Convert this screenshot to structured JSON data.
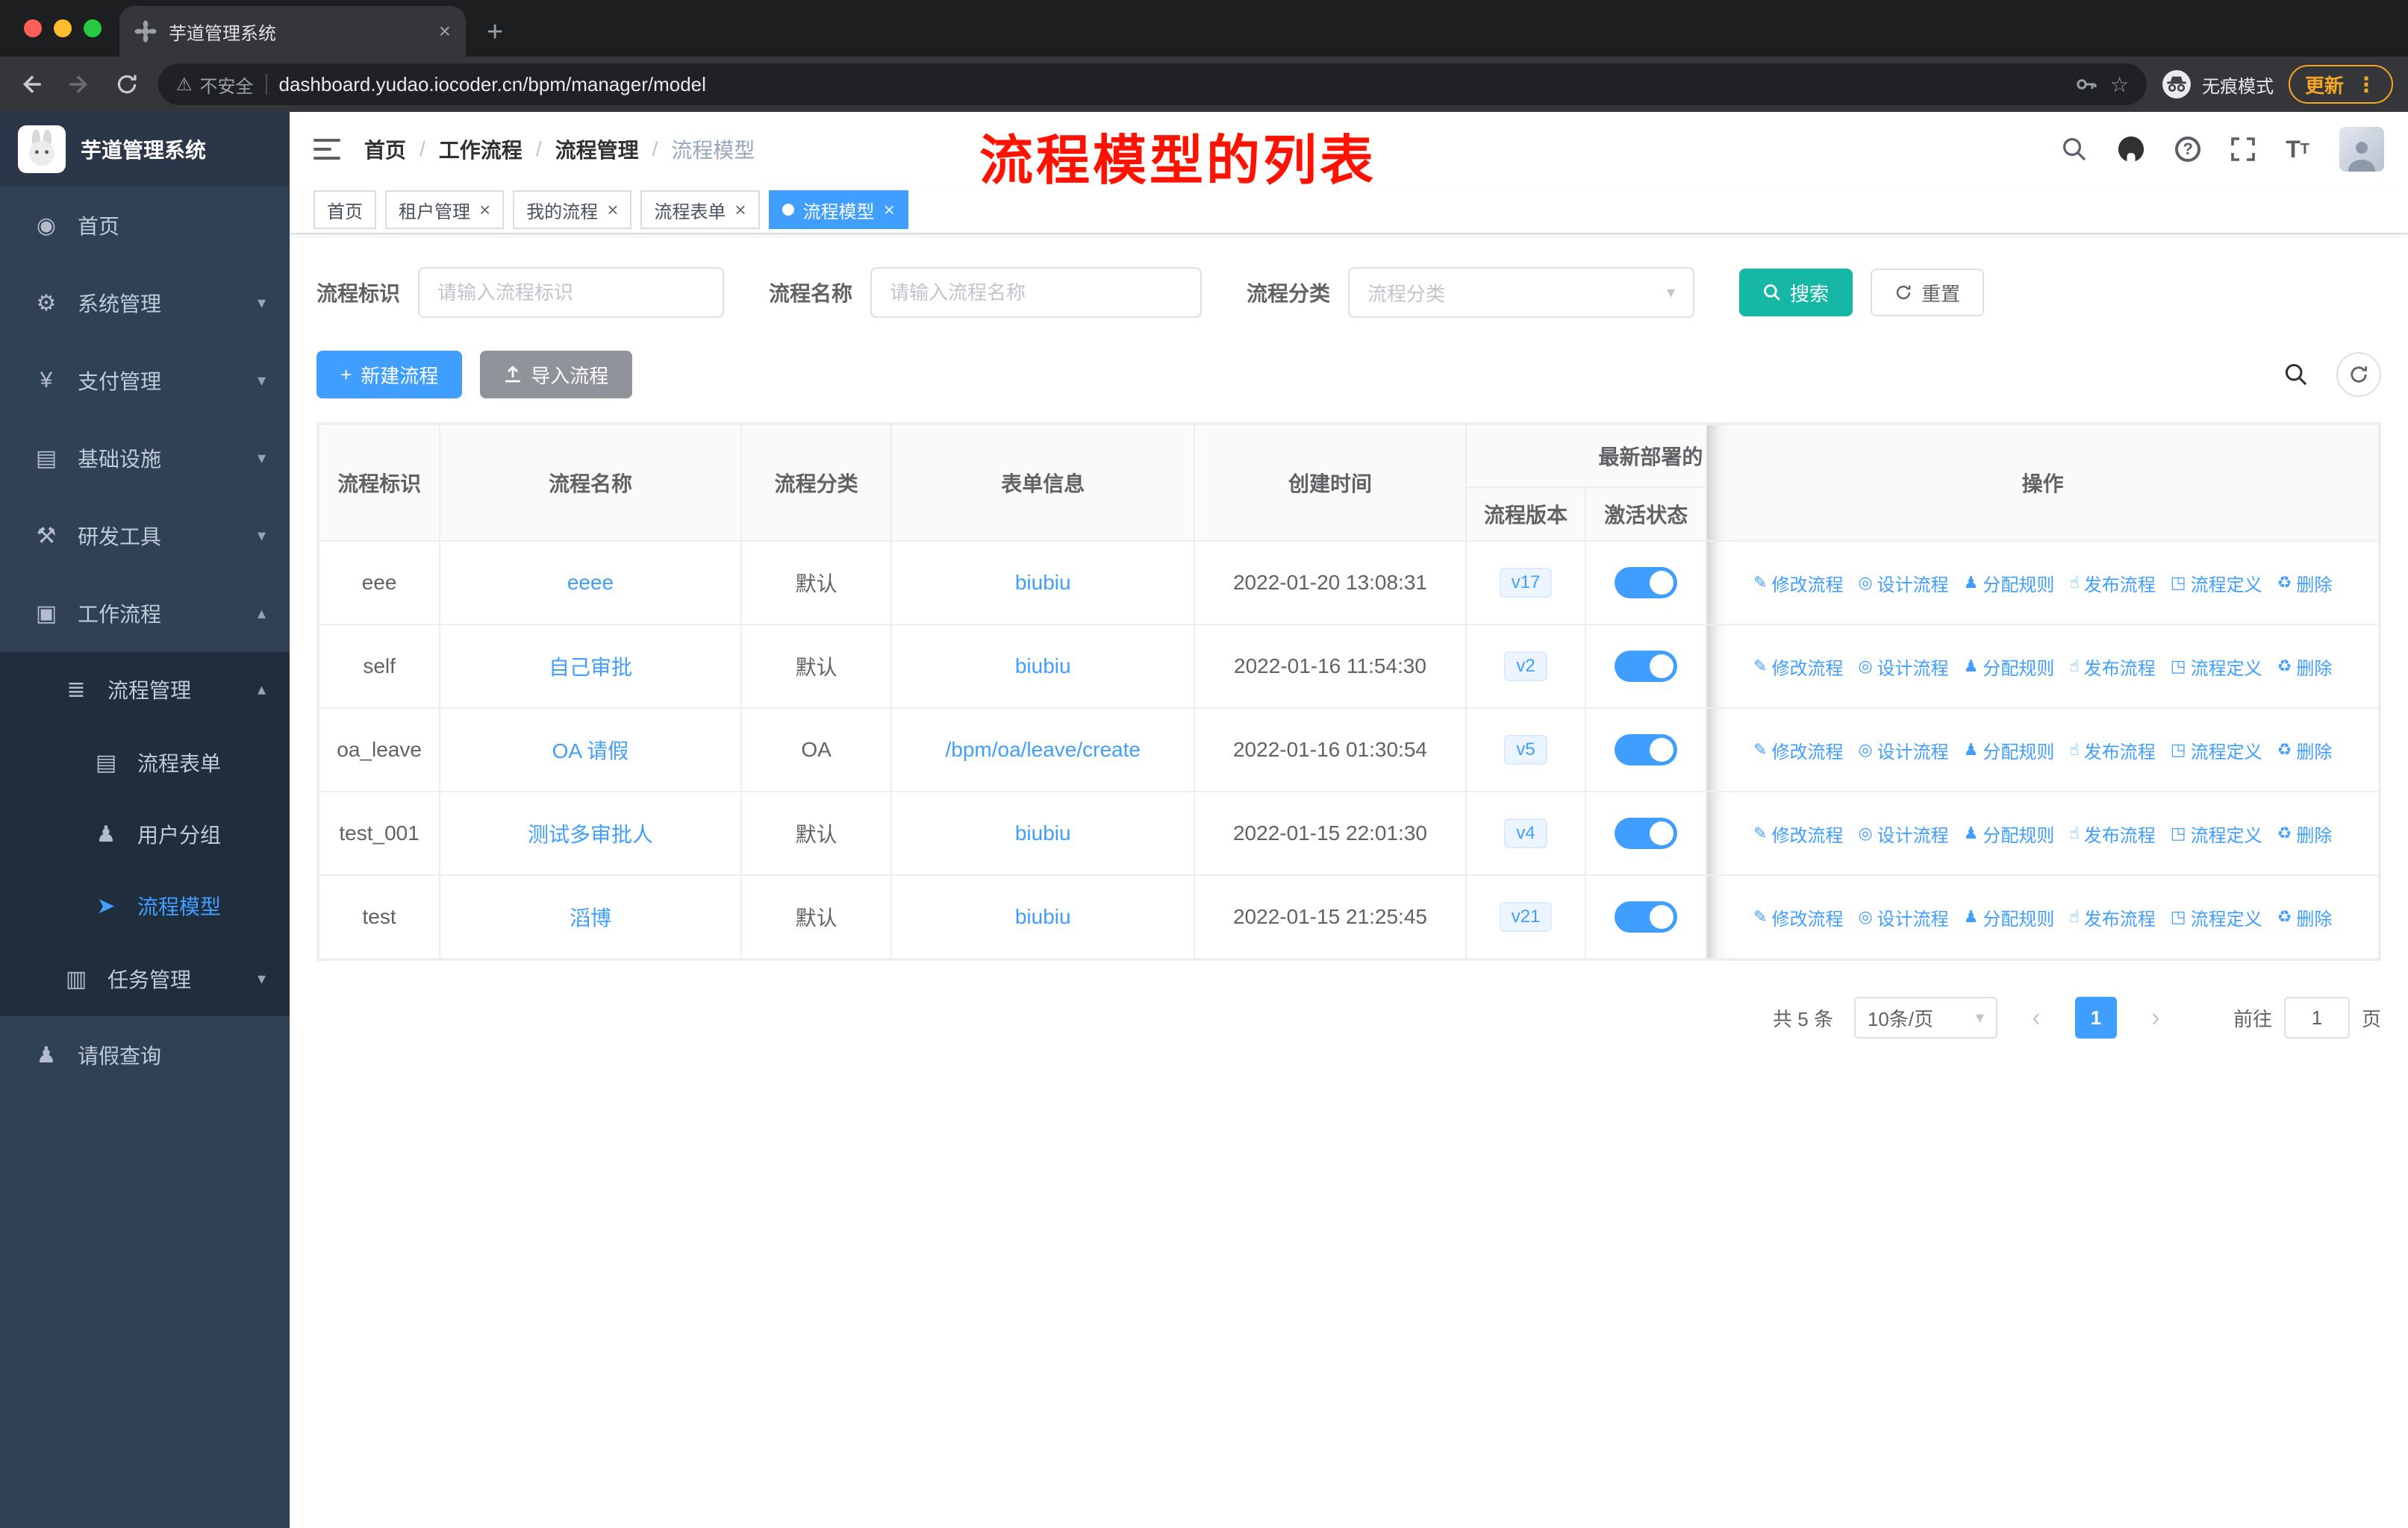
{
  "colors": {
    "accent_blue": "#409eff",
    "link_blue": "#409eff",
    "search_teal": "#16b8a5",
    "annotation_red": "#ff1200",
    "sidebar_bg": "#304156",
    "submenu_bg": "#1f2d3d",
    "sidebar_text": "#bfcbd9",
    "update_orange": "#f5a623"
  },
  "browser": {
    "tab_title": "芋道管理系统",
    "security_label": "不安全",
    "url": "dashboard.yudao.iocoder.cn/bpm/manager/model",
    "incognito_label": "无痕模式",
    "update_label": "更新"
  },
  "sidebar": {
    "logo_title": "芋道管理系统",
    "items": [
      {
        "key": "home",
        "label": "首页",
        "depth": 0,
        "icon": "◉",
        "icon_name": "dashboard-icon",
        "chevron": null,
        "active": false
      },
      {
        "key": "system",
        "label": "系统管理",
        "depth": 0,
        "icon": "⚙",
        "icon_name": "gear-icon",
        "chevron": "down",
        "active": false
      },
      {
        "key": "payment",
        "label": "支付管理",
        "depth": 0,
        "icon": "¥",
        "icon_name": "yen-icon",
        "chevron": "down",
        "active": false
      },
      {
        "key": "infrastructure",
        "label": "基础设施",
        "depth": 0,
        "icon": "▤",
        "icon_name": "server-icon",
        "chevron": "down",
        "active": false
      },
      {
        "key": "dev-tools",
        "label": "研发工具",
        "depth": 0,
        "icon": "⚒",
        "icon_name": "tools-icon",
        "chevron": "down",
        "active": false
      },
      {
        "key": "workflow",
        "label": "工作流程",
        "depth": 0,
        "icon": "▣",
        "icon_name": "briefcase-icon",
        "chevron": "up",
        "active": false
      },
      {
        "key": "process-mgmt",
        "label": "流程管理",
        "depth": 1,
        "icon": "≣",
        "icon_name": "list-icon",
        "chevron": "up",
        "active": false
      },
      {
        "key": "process-form",
        "label": "流程表单",
        "depth": 2,
        "icon": "▤",
        "icon_name": "form-icon",
        "chevron": null,
        "active": false
      },
      {
        "key": "user-group",
        "label": "用户分组",
        "depth": 2,
        "icon": "♟",
        "icon_name": "user-group-icon",
        "chevron": null,
        "active": false
      },
      {
        "key": "process-model",
        "label": "流程模型",
        "depth": 2,
        "icon": "➤",
        "icon_name": "paper-plane-icon",
        "chevron": null,
        "active": true
      },
      {
        "key": "task-mgmt",
        "label": "任务管理",
        "depth": 1,
        "icon": "▥",
        "icon_name": "task-icon",
        "chevron": "down",
        "active": false
      },
      {
        "key": "leave-query",
        "label": "请假查询",
        "depth": 0,
        "icon": "♟",
        "icon_name": "person-icon",
        "chevron": null,
        "active": false
      }
    ]
  },
  "header": {
    "breadcrumb": [
      "首页",
      "工作流程",
      "流程管理",
      "流程模型"
    ],
    "annotation": "流程模型的列表"
  },
  "tabs": [
    {
      "label": "首页",
      "closable": false,
      "active": false
    },
    {
      "label": "租户管理",
      "closable": true,
      "active": false
    },
    {
      "label": "我的流程",
      "closable": true,
      "active": false
    },
    {
      "label": "流程表单",
      "closable": true,
      "active": false
    },
    {
      "label": "流程模型",
      "closable": true,
      "active": true
    }
  ],
  "filters": {
    "id_label": "流程标识",
    "id_placeholder": "请输入流程标识",
    "name_label": "流程名称",
    "name_placeholder": "请输入流程名称",
    "category_label": "流程分类",
    "category_placeholder": "流程分类",
    "search_label": "搜索",
    "reset_label": "重置"
  },
  "toolbar": {
    "create_label": "新建流程",
    "import_label": "导入流程"
  },
  "table": {
    "headers": {
      "id": "流程标识",
      "name": "流程名称",
      "category": "流程分类",
      "form": "表单信息",
      "created": "创建时间",
      "group": "最新部署的",
      "version": "流程版本",
      "active": "激活状态",
      "actions": "操作"
    },
    "actions": [
      {
        "key": "edit",
        "label": "修改流程",
        "icon": "✎"
      },
      {
        "key": "design",
        "label": "设计流程",
        "icon": "◎"
      },
      {
        "key": "assign-rule",
        "label": "分配规则",
        "icon": "♟"
      },
      {
        "key": "publish",
        "label": "发布流程",
        "icon": "☝"
      },
      {
        "key": "definition",
        "label": "流程定义",
        "icon": "◳"
      },
      {
        "key": "delete",
        "label": "删除",
        "icon": "♻"
      }
    ],
    "rows": [
      {
        "id": "eee",
        "name": "eeee",
        "category": "默认",
        "form": "biubiu",
        "created": "2022-01-20 13:08:31",
        "version": "v17",
        "active": true
      },
      {
        "id": "self",
        "name": "自己审批",
        "category": "默认",
        "form": "biubiu",
        "created": "2022-01-16 11:54:30",
        "version": "v2",
        "active": true
      },
      {
        "id": "oa_leave",
        "name": "OA 请假",
        "category": "OA",
        "form": "/bpm/oa/leave/create",
        "created": "2022-01-16 01:30:54",
        "version": "v5",
        "active": true
      },
      {
        "id": "test_001",
        "name": "测试多审批人",
        "category": "默认",
        "form": "biubiu",
        "created": "2022-01-15 22:01:30",
        "version": "v4",
        "active": true
      },
      {
        "id": "test",
        "name": "滔博",
        "category": "默认",
        "form": "biubiu",
        "created": "2022-01-15 21:25:45",
        "version": "v21",
        "active": true
      }
    ]
  },
  "pagination": {
    "total": "共 5 条",
    "page_size": "10条/页",
    "current_page": "1",
    "goto_label": "前往",
    "goto_value": "1",
    "page_unit": "页"
  }
}
